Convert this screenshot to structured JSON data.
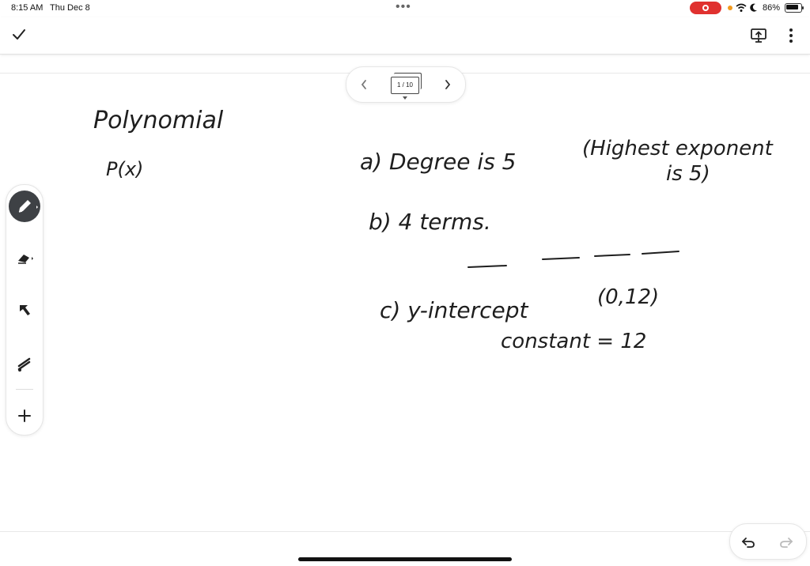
{
  "status_bar": {
    "time": "8:15 AM",
    "date": "Thu Dec 8",
    "battery_percent": "86%",
    "multitask_dots": "•••"
  },
  "toolbar": {
    "done_icon": "check-icon",
    "present_icon": "present-icon",
    "more_icon": "more-vertical-icon"
  },
  "page_nav": {
    "page_label": "1 / 10",
    "prev_icon": "chevron-left-icon",
    "next_icon": "chevron-right-icon"
  },
  "tools": {
    "items": [
      "pen-icon",
      "eraser-icon",
      "select-arrow-icon",
      "laser-icon",
      "add-icon"
    ],
    "active": "pen"
  },
  "notes": {
    "title": "Polynomial",
    "function": "P(x)",
    "line_a": "a) Degree is 5",
    "line_a_note": "(Highest exponent",
    "line_a_note2": "is 5)",
    "line_b": "b) 4 terms.",
    "line_c": "c) y-intercept",
    "line_c_point": "(0,12)",
    "line_c2": "constant = 12"
  },
  "colors": {
    "ink": "#1e1e1e",
    "accent_record": "#e0312f",
    "pen_button": "#3e4145"
  },
  "controls": {
    "undo_icon": "undo-icon",
    "redo_icon": "redo-icon"
  }
}
